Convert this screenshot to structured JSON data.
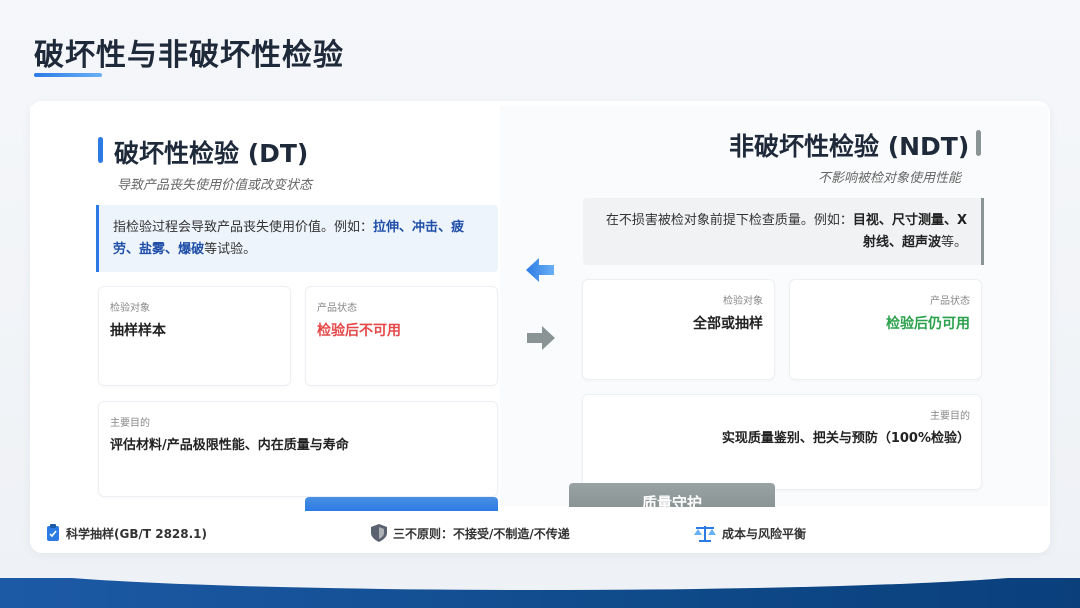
{
  "page": {
    "title": "破坏性与非破坏性检验"
  },
  "dt": {
    "title": "破坏性检验 (DT)",
    "subtitle": "导致产品丧失使用价值或改变状态",
    "desc_line1_prefix": "指检验过程会导致产品丧失使用价值。例如：",
    "desc_hl1": "拉伸",
    "desc_sep1": "、",
    "desc_hl2": "冲击",
    "desc_sep2": "、",
    "desc_hl3": "疲劳",
    "desc_sep3": "、",
    "desc_hl4": "盐雾",
    "desc_sep4": "、",
    "desc_hl5": "爆破",
    "desc_suffix": "等试验。",
    "object_label": "检验对象",
    "object_value": "抽样样本",
    "state_label": "产品状态",
    "state_value": "检验后不可用",
    "purpose_label": "主要目的",
    "purpose_value": "评估材料/产品极限性能、内在质量与寿命"
  },
  "ndt": {
    "title": "非破坏性检验 (NDT)",
    "subtitle": "不影响被检对象使用性能",
    "desc_prefix": "在不损害被检对象前提下检查质量。例如：",
    "desc_hl1": "目视",
    "desc_sep1": "、",
    "desc_hl2": "尺寸测量",
    "desc_sep2": "、",
    "desc_hl3": "X射线",
    "desc_sep3": "、",
    "desc_hl4": "超声波",
    "desc_suffix": "等。",
    "object_label": "检验对象",
    "object_value": "全部或抽样",
    "state_label": "产品状态",
    "state_value": "检验后仍可用",
    "purpose_label": "主要目的",
    "purpose_value": "实现质量鉴别、把关与预防（100%检验）"
  },
  "tab_right": {
    "label": "质量守护"
  },
  "footer": {
    "item1": "科学抽样(GB/T 2828.1)",
    "item2": "三不原则：不接受/不制造/不传递",
    "item3": "成本与风险平衡"
  },
  "colors": {
    "accent_blue": "#2c7be5",
    "highlight_blue": "#1f4fa8",
    "danger_red": "#e54848",
    "success_green": "#2aa14b",
    "gray_bar": "#8a9494"
  },
  "icons": {
    "left_arrow": "arrow-left-icon",
    "right_arrow": "arrow-right-icon",
    "clipboard": "clipboard-check-icon",
    "shield": "shield-icon",
    "scale": "balance-scale-icon"
  }
}
